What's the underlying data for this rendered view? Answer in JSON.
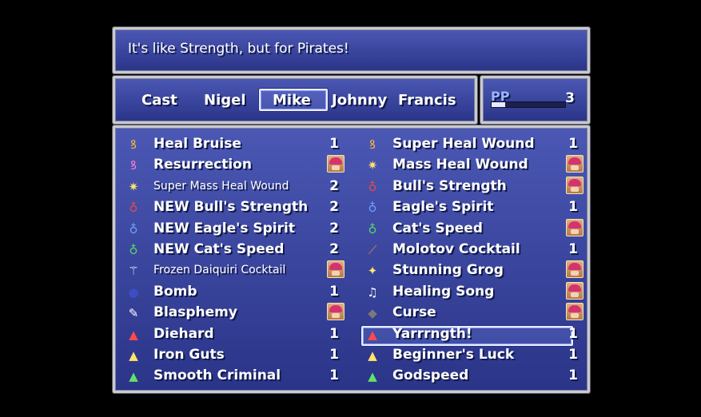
{
  "help": {
    "text": "It's like Strength, but for Pirates!"
  },
  "party": {
    "command": "Cast",
    "members": [
      "Nigel",
      "Mike",
      "Johnny",
      "Francis"
    ],
    "selected": "Mike"
  },
  "pp": {
    "label": "PP",
    "value": "3",
    "gauge_fill_percent": 18
  },
  "skills_left": [
    {
      "name": "Heal Bruise",
      "value": "1",
      "icon": "orange-swirl-icon"
    },
    {
      "name": "Resurrection",
      "value": "",
      "icon": "pink-swirl-icon",
      "face": true
    },
    {
      "name": "Super Mass Heal Wound",
      "value": "2",
      "icon": "sparkle-cluster-icon",
      "small": true
    },
    {
      "name": "NEW Bull's Strength",
      "value": "2",
      "icon": "red-potion-icon"
    },
    {
      "name": "NEW Eagle's Spirit",
      "value": "2",
      "icon": "blue-potion-icon"
    },
    {
      "name": "NEW Cat's Speed",
      "value": "2",
      "icon": "green-potion-icon"
    },
    {
      "name": "Frozen Daiquiri Cocktail",
      "value": "",
      "icon": "cocktail-icon",
      "face": true,
      "small": true
    },
    {
      "name": "Bomb",
      "value": "1",
      "icon": "bomb-icon"
    },
    {
      "name": "Blasphemy",
      "value": "",
      "icon": "speech-symbols-icon",
      "face": true
    },
    {
      "name": "Diehard",
      "value": "1",
      "icon": "hp-up-icon"
    },
    {
      "name": "Iron Guts",
      "value": "1",
      "icon": "res-up-icon"
    },
    {
      "name": "Smooth Criminal",
      "value": "1",
      "icon": "eva-up-icon"
    }
  ],
  "skills_right": [
    {
      "name": "Super Heal Wound",
      "value": "1",
      "icon": "orange-swirl-icon"
    },
    {
      "name": "Mass Heal Wound",
      "value": "",
      "icon": "sparkle-cluster-icon",
      "face": true
    },
    {
      "name": "Bull's Strength",
      "value": "",
      "icon": "red-potion-icon",
      "face": true
    },
    {
      "name": "Eagle's Spirit",
      "value": "1",
      "icon": "blue-potion-icon"
    },
    {
      "name": "Cat's Speed",
      "value": "",
      "icon": "green-potion-icon",
      "face": true
    },
    {
      "name": "Molotov Cocktail",
      "value": "1",
      "icon": "molotov-icon"
    },
    {
      "name": "Stunning Grog",
      "value": "",
      "icon": "stars-icon",
      "face": true
    },
    {
      "name": "Healing Song",
      "value": "",
      "icon": "music-note-icon",
      "face": true
    },
    {
      "name": "Curse",
      "value": "",
      "icon": "dark-orb-icon",
      "face": true
    },
    {
      "name": "Yarrrngth!",
      "value": "1",
      "icon": "str-up-icon",
      "selected": true
    },
    {
      "name": "Beginner's Luck",
      "value": "1",
      "icon": "cri-up-icon"
    },
    {
      "name": "Godspeed",
      "value": "1",
      "icon": "spd-up-icon"
    }
  ]
}
